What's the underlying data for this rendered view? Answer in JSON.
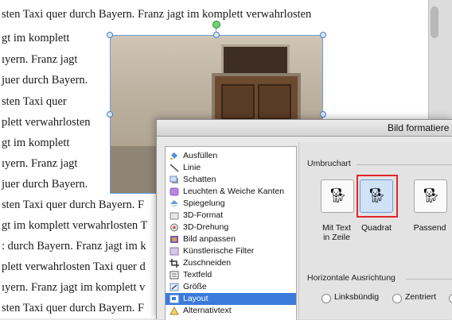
{
  "document": {
    "lines": [
      "sten Taxi quer durch Bayern. Franz jagt im komplett verwahrlosten",
      "gt im komplett",
      "ıyern. Franz jagt",
      "juer durch Bayern.",
      "sten Taxi quer",
      "plett verwahrlosten",
      "gt im komplett",
      "ıyern. Franz jagt",
      "juer durch Bayern.",
      "sten Taxi quer durch Bayern. F",
      "gt im komplett verwahrlosten T",
      ": durch Bayern. Franz jagt im k",
      "plett verwahrlosten Taxi quer d",
      "ıyern. Franz jagt im komplett v",
      "sten Taxi quer durch Bayern. F"
    ]
  },
  "dialog": {
    "title": "Bild formatiere",
    "categories": [
      {
        "label": "Ausfüllen",
        "icon": "paint-bucket-icon"
      },
      {
        "label": "Linie",
        "icon": "line-icon"
      },
      {
        "label": "Schatten",
        "icon": "shadow-icon"
      },
      {
        "label": "Leuchten & Weiche Kanten",
        "icon": "glow-icon"
      },
      {
        "label": "Spiegelung",
        "icon": "reflection-icon"
      },
      {
        "label": "3D-Format",
        "icon": "3d-format-icon"
      },
      {
        "label": "3D-Drehung",
        "icon": "3d-rotation-icon"
      },
      {
        "label": "Bild anpassen",
        "icon": "picture-adjust-icon"
      },
      {
        "label": "Künstlerische Filter",
        "icon": "artistic-filter-icon"
      },
      {
        "label": "Zuschneiden",
        "icon": "crop-icon"
      },
      {
        "label": "Textfeld",
        "icon": "textbox-icon"
      },
      {
        "label": "Größe",
        "icon": "size-icon"
      },
      {
        "label": "Layout",
        "icon": "layout-icon"
      },
      {
        "label": "Alternativtext",
        "icon": "alt-text-icon"
      }
    ],
    "selected_category": "Layout",
    "wrap": {
      "group_label": "Umbruchart",
      "options": [
        {
          "label_line1": "Mit Text",
          "label_line2": "in Zeile"
        },
        {
          "label_line1": "Quadrat",
          "label_line2": ""
        },
        {
          "label_line1": "Passend",
          "label_line2": ""
        }
      ],
      "selected": "Quadrat"
    },
    "horizontal": {
      "group_label": "Horizontale Ausrichtung",
      "options": [
        "Linksbündig",
        "Zentriert"
      ]
    }
  },
  "colors": {
    "selection_blue": "#3b7ad9",
    "highlight_red": "#e0262a"
  }
}
